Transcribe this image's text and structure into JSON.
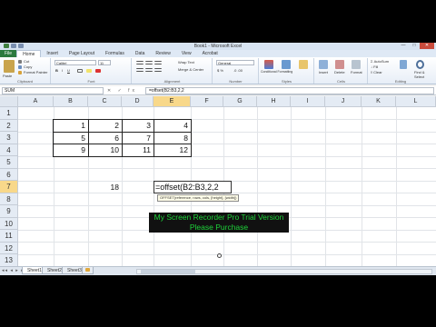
{
  "window": {
    "title": "Book1 - Microsoft Excel",
    "minimize": "—",
    "maximize": "□",
    "close": "✕"
  },
  "ribbon_tabs": [
    "File",
    "Home",
    "Insert",
    "Page Layout",
    "Formulas",
    "Data",
    "Review",
    "View",
    "Acrobat"
  ],
  "ribbon": {
    "clipboard": {
      "paste": "Paste",
      "cut": "Cut",
      "copy": "Copy",
      "format_painter": "Format Painter",
      "group": "Clipboard"
    },
    "font": {
      "family": "Calibri",
      "size": "11",
      "group": "Font"
    },
    "alignment": {
      "wrap": "Wrap Text",
      "merge": "Merge & Center",
      "group": "Alignment"
    },
    "number": {
      "format": "General",
      "group": "Number"
    },
    "styles": {
      "conditional": "Conditional Formatting",
      "table": "Format as Table",
      "cell": "Cell Styles",
      "group": "Styles"
    },
    "cells": {
      "insert": "Insert",
      "delete": "Delete",
      "format": "Format",
      "group": "Cells"
    },
    "editing": {
      "autosum": "AutoSum",
      "fill": "Fill",
      "clear": "Clear",
      "sort": "Sort & Filter",
      "find": "Find & Select",
      "group": "Editing"
    }
  },
  "formula_bar": {
    "name_box": "SUM",
    "fx_icons": "✕ ✓ fx",
    "formula": "=offset(B2:B3,2,2"
  },
  "columns": [
    "A",
    "B",
    "C",
    "D",
    "E",
    "F",
    "G",
    "H",
    "I",
    "J",
    "K",
    "L"
  ],
  "rows": [
    "1",
    "2",
    "3",
    "4",
    "5",
    "6",
    "7",
    "8",
    "9",
    "10",
    "11",
    "12",
    "13",
    "14",
    "15"
  ],
  "cells": {
    "b2": "1",
    "c2": "2",
    "d2": "3",
    "e2": "4",
    "b3": "5",
    "c3": "6",
    "d3": "7",
    "e3": "8",
    "b4": "9",
    "c4": "10",
    "d4": "11",
    "e4": "12",
    "c7": "18"
  },
  "edit_cell": "=offset(B2:B3,2,2",
  "tooltip": "OFFSET(reference, rows, cols, [height], [width])",
  "sheets": [
    "Sheet1",
    "Sheet2",
    "Sheet3"
  ],
  "sheet_nav": "◂◂ ◂ ▸ ▸▸",
  "watermark": {
    "line1": "My Screen Recorder Pro Trial Version",
    "line2": "Please Purchase"
  }
}
